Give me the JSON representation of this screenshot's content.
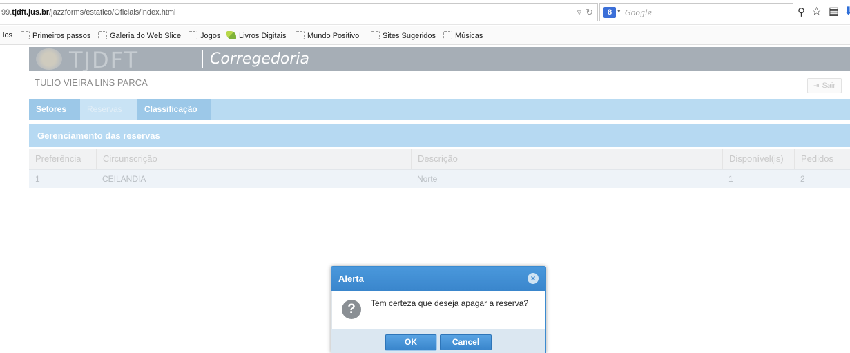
{
  "browser": {
    "url_prefix": "99.",
    "url_domain": "tjdft.jus.br",
    "url_path": "/jazzforms/estatico/Oficiais/index.html",
    "search_placeholder": "Google",
    "bookmarks": [
      "los",
      "Primeiros passos",
      "Galeria do Web Slice",
      "Jogos",
      "Livros Digitais",
      "Mundo Positivo",
      "Sites Sugeridos",
      "Músicas"
    ]
  },
  "header": {
    "brand": "TJDFT",
    "title": "Corregedoria"
  },
  "user": {
    "name": "TULIO VIEIRA LINS PARCA",
    "logout_label": "Sair"
  },
  "tabs": [
    {
      "label": "Setores"
    },
    {
      "label": "Reservas"
    },
    {
      "label": "Classificação"
    }
  ],
  "section": {
    "title": "Gerenciamento das reservas"
  },
  "table": {
    "columns": [
      "Preferência",
      "Circunscrição",
      "Descrição",
      "Disponível(is)",
      "Pedidos"
    ],
    "rows": [
      [
        "1",
        "CEILANDIA",
        "Norte",
        "1",
        "2"
      ]
    ]
  },
  "dialog": {
    "title": "Alerta",
    "message": "Tem certeza que deseja apagar a reserva?",
    "ok_label": "OK",
    "cancel_label": "Cancel"
  }
}
